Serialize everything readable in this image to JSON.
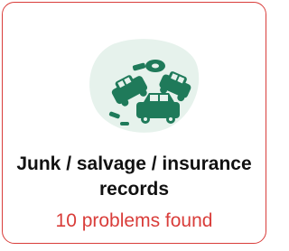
{
  "card": {
    "title": "Junk / salvage / insurance records",
    "status": "10 problems found",
    "icon": "junkyard-cars-icon",
    "colors": {
      "border": "#d93d3a",
      "status_text": "#d93d3a",
      "blob": "#e6f2ec",
      "icon": "#1f7a5a"
    }
  }
}
